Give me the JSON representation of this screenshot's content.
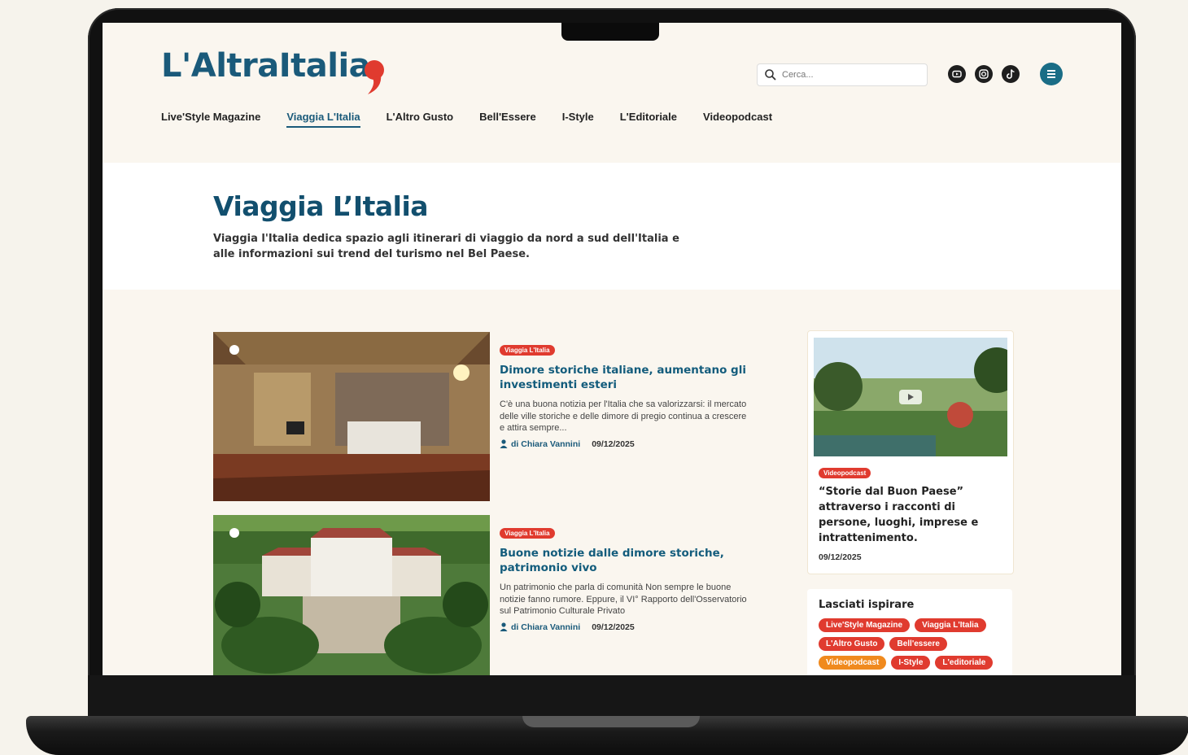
{
  "brand": {
    "logo_text": "L'AltraItalia"
  },
  "search": {
    "placeholder": "Cerca..."
  },
  "social": [
    "youtube-icon",
    "instagram-icon",
    "tiktok-icon"
  ],
  "nav": [
    {
      "label": "Live'Style Magazine"
    },
    {
      "label": "Viaggia L'Italia"
    },
    {
      "label": "L'Altro Gusto"
    },
    {
      "label": "Bell'Essere"
    },
    {
      "label": "I-Style"
    },
    {
      "label": "L'Editoriale"
    },
    {
      "label": "Videopodcast"
    }
  ],
  "nav_active": "Viaggia L'Italia",
  "hero": {
    "title": "Viaggia L’Italia",
    "description": "Viaggia l'Italia dedica spazio agli itinerari di viaggio da nord a sud dell'Italia e alle informazioni sui trend del turismo nel Bel Paese."
  },
  "articles": [
    {
      "badge": "Viaggia L'Italia",
      "title": "Dimore storiche italiane, aumentano gli investimenti esteri",
      "excerpt": "C'è una buona notizia per l'Italia che sa valorizzarsi: il mercato delle ville storiche e delle dimore di pregio continua a crescere e attira sempre...",
      "author": "di Chiara Vannini",
      "date": "09/12/2025"
    },
    {
      "badge": "Viaggia L'Italia",
      "title": "Buone notizie dalle dimore storiche, patrimonio vivo",
      "excerpt": "Un patrimonio che parla di comunità Non sempre le buone notizie fanno rumore. Eppure, il VI° Rapporto dell'Osservatorio sul Patrimonio Culturale Privato",
      "author": "di Chiara Vannini",
      "date": "09/12/2025"
    }
  ],
  "video": {
    "badge": "Videopodcast",
    "title": "“Storie dal Buon Paese” attraverso i racconti di persone, luoghi, imprese e intrattenimento.",
    "date": "09/12/2025"
  },
  "inspire": {
    "title": "Lasciati ispirare",
    "tags": [
      "Live'Style Magazine",
      "Viaggia L'Italia",
      "L'Altro Gusto",
      "Bell'essere",
      "Videopodcast",
      "I-Style",
      "L'editoriale"
    ]
  },
  "colors": {
    "brand": "#1a5a7a",
    "accent": "#e03b2f",
    "orange": "#f08a1e",
    "background": "#faf6ef"
  }
}
